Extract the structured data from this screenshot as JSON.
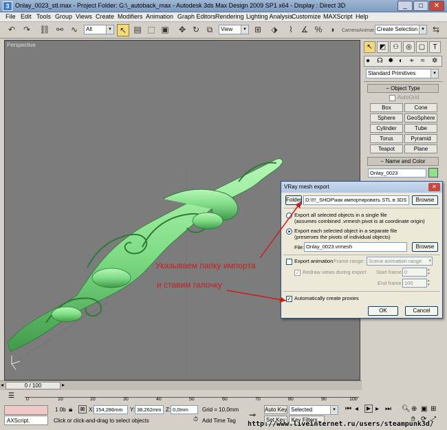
{
  "window": {
    "title": "Onlay_0023_stl.max     - Project Folder: G:\\_autoback_max     - Autodesk 3ds Max Design 2009 SP1  x64     - Display : Direct 3D",
    "minimize": "_",
    "maximize": "□",
    "close": "✕"
  },
  "menu": [
    "File",
    "Edit",
    "Tools",
    "Group",
    "Views",
    "Create",
    "Modifiers",
    "Animation",
    "Graph Editors",
    "Rendering",
    "Lighting Analysis",
    "Customize",
    "MAXScript",
    "Help"
  ],
  "toolbar": {
    "selection_filter": "All",
    "ref_coord": "View",
    "camera_label": "CameraAnimat",
    "named_selection": "Create Selection Set"
  },
  "viewport": {
    "label": "Perspective"
  },
  "command_panel": {
    "category": "Standard Primitives",
    "object_type_title": "Object Type",
    "autogrid": "AutoGrid",
    "buttons": [
      "Box",
      "Cone",
      "Sphere",
      "GeoSphere",
      "Cylinder",
      "Tube",
      "Torus",
      "Pyramid",
      "Teapot",
      "Plane"
    ],
    "name_color_title": "Name and Color",
    "object_name": "Onlay_0023",
    "object_color": "#8fe08f"
  },
  "dialog": {
    "title": "VRay mesh export",
    "close": "✕",
    "folder_label": "Folder",
    "folder_value": "D:\\!!!_SHOP\\как импортировать STL в 3DS",
    "browse1": "Browse",
    "option1": "Export all selected objects in a single file",
    "option1_note": "(assumes combined .vrmesh pivot is at coordinate origin)",
    "option2": "Export each selected object in a separate file",
    "option2_note": "(preserves the pivots of individual objects)",
    "file_label": "File:",
    "file_value": "Onlay_0023.vrmesh",
    "browse2": "Browse",
    "export_anim": "Export animation",
    "frame_range_label": "Frame range:",
    "frame_range_value": "Scene animation range",
    "redraw": "Redraw views during export",
    "start_frame_label": "Start frame:",
    "start_frame_value": "0",
    "end_frame_label": "End frame:",
    "end_frame_value": "100",
    "auto_proxies": "Automatically create proxies",
    "ok": "OK",
    "cancel": "Cancel"
  },
  "annotations": {
    "line1": "Указываем папку импорта",
    "line2": "и ставим галочку"
  },
  "timeline": {
    "frame_counter": "0 / 100",
    "ticks": [
      "0",
      "10",
      "20",
      "30",
      "40",
      "50",
      "60",
      "70",
      "80",
      "90",
      "100"
    ]
  },
  "status": {
    "maxscript": "AXScript.",
    "layer": "1 0b",
    "x_label": "X:",
    "x_value": "154,286mm",
    "y_label": "Y:",
    "y_value": "38,262mm",
    "z_label": "Z:",
    "z_value": "0,0mm",
    "grid": "Grid = 10,0mm",
    "prompt": "Click or click-and-drag to select objects",
    "add_time_tag": "Add Time Tag",
    "auto_key": "Auto Key",
    "auto_key_value": "Selected",
    "set_key": "Set Key",
    "key_filters": "Key Filters...",
    "watermark": "http://www.liveinternet.ru/users/steampunk3d/"
  }
}
